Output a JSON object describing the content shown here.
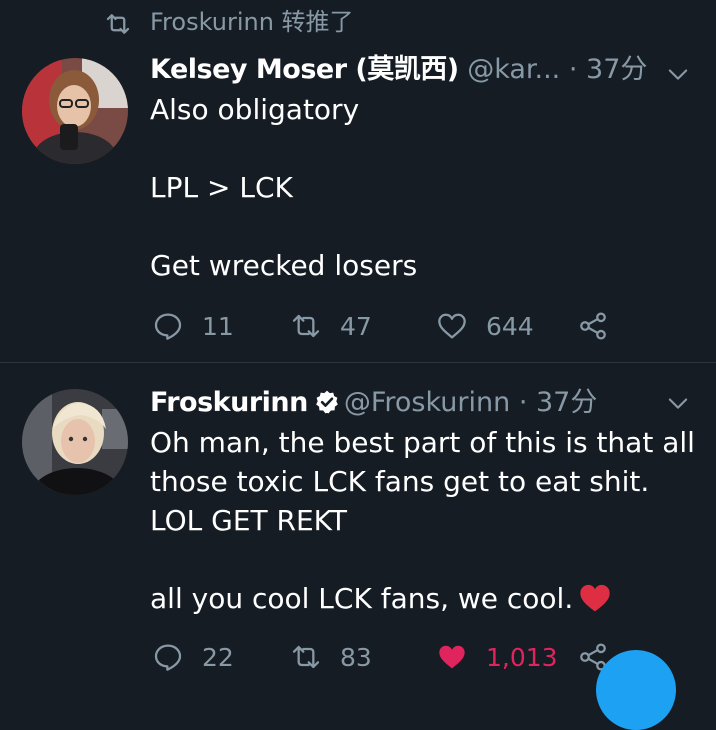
{
  "retweet_context": {
    "icon": "retweet-icon",
    "text": "Froskurinn 转推了"
  },
  "tweets": [
    {
      "display_name": "Kelsey Moser (莫凯西)",
      "handle": "@kar...",
      "timestamp": "· 37分",
      "verified": false,
      "paragraphs": [
        "Also obligatory",
        "LPL > LCK",
        "Get wrecked losers"
      ],
      "counts": {
        "reply": "11",
        "retweet": "47",
        "like": "644"
      },
      "liked": false
    },
    {
      "display_name": "Froskurinn",
      "handle": "@Froskurinn",
      "timestamp": "· 37分",
      "verified": true,
      "paragraphs": [
        "Oh man, the best part of this is that all those toxic LCK fans get to eat shit. LOL GET REKT",
        "all you cool LCK fans, we cool."
      ],
      "counts": {
        "reply": "22",
        "retweet": "83",
        "like": "1,013"
      },
      "liked": true
    }
  ],
  "colors": {
    "background": "#151c24",
    "secondary_text": "#8899a6",
    "like_active": "#e0245e",
    "verified": "#ffffff",
    "fab": "#1da1f2",
    "heart_emoji": "#dd2e44"
  }
}
